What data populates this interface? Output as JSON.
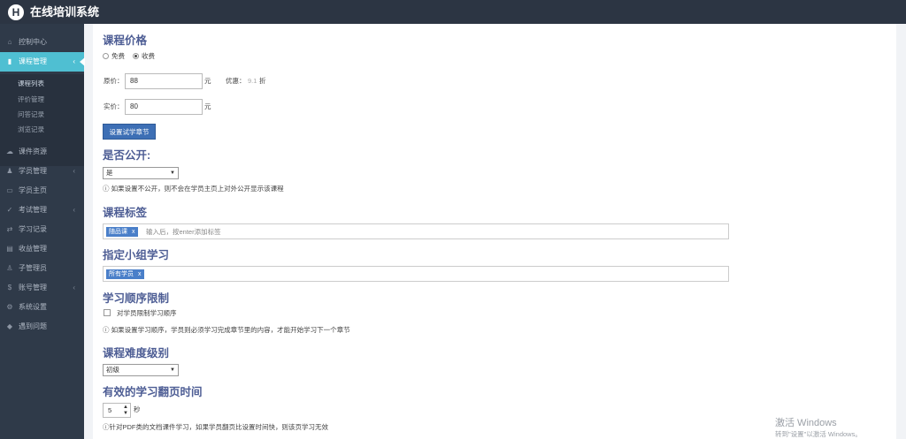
{
  "app": {
    "logo_letter": "H",
    "title": "在线培训系统"
  },
  "sidebar": {
    "items": [
      {
        "name": "dashboard",
        "icon": "⌂",
        "label": "控制中心",
        "arrow": ""
      },
      {
        "name": "course-manage",
        "icon": "▮",
        "label": "课程管理",
        "arrow": "‹"
      },
      {
        "name": "courseware",
        "icon": "☁",
        "label": "课件资源",
        "arrow": ""
      },
      {
        "name": "student-manage",
        "icon": "♟",
        "label": "学员管理",
        "arrow": "‹"
      },
      {
        "name": "student-home",
        "icon": "▭",
        "label": "学员主页",
        "arrow": ""
      },
      {
        "name": "exam-manage",
        "icon": "✓",
        "label": "考试管理",
        "arrow": "‹"
      },
      {
        "name": "study-records",
        "icon": "⇄",
        "label": "学习记录",
        "arrow": ""
      },
      {
        "name": "revenue",
        "icon": "▤",
        "label": "收益管理",
        "arrow": ""
      },
      {
        "name": "sub-admin",
        "icon": "♙",
        "label": "子管理员",
        "arrow": ""
      },
      {
        "name": "account",
        "icon": "$",
        "label": "账号管理",
        "arrow": "‹"
      },
      {
        "name": "settings",
        "icon": "⚙",
        "label": "系统设置",
        "arrow": ""
      },
      {
        "name": "problems",
        "icon": "◆",
        "label": "遇到问题",
        "arrow": ""
      }
    ],
    "sub_items": [
      "课程列表",
      "评价管理",
      "问答记录",
      "浏览记录"
    ]
  },
  "form": {
    "price_title": "课程价格",
    "free_label": "免费",
    "paid_label": "收费",
    "original_price_label": "原价：",
    "original_price": "88",
    "unit_yuan": "元",
    "discount_label": "优惠：",
    "discount_value": "9.1",
    "discount_unit": "折",
    "actual_price_label": "实价：",
    "actual_price": "80",
    "trial_button": "设置试学章节",
    "public_title": "是否公开:",
    "public_value": "是",
    "public_hint": "ⓘ 如果设置不公开，则不会在学员主页上对外公开显示该课程",
    "tags_title": "课程标签",
    "tag": "随品课",
    "tag_placeholder": "输入后，按enter添加标签",
    "group_title": "指定小组学习",
    "group_tag": "所有学员",
    "order_title": "学习顺序限制",
    "order_checkbox_label": "对学员限制学习顺序",
    "order_hint": "ⓘ 如果设置学习顺序，学员则必须学习完成章节里的内容，才能开始学习下一个章节",
    "level_title": "课程难度级别",
    "level_value": "初级",
    "flip_title": "有效的学习翻页时间",
    "flip_value": "5",
    "flip_unit": "秒",
    "flip_hint": "ⓘ针对PDF类的文档课件学习，如果学员翻页比设置时间快，则该页学习无效"
  },
  "watermark": {
    "line1": "激活 Windows",
    "line2": "转到\"设置\"以激活 Windows。"
  }
}
